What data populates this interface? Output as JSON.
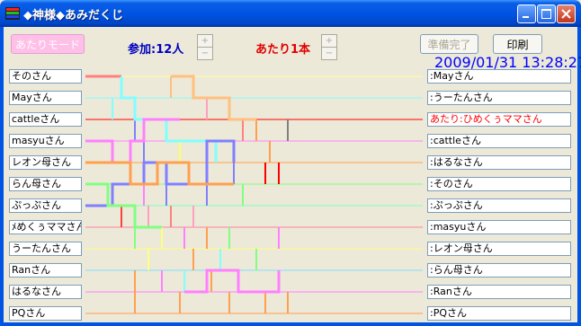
{
  "window": {
    "title": "◆神様◆あみだくじ"
  },
  "toolbar": {
    "atari_mode": "あたりモード",
    "participants": "参加:12人",
    "hits": "あたり1本",
    "ready": "準備完了",
    "print": "印刷",
    "spin_up": "+",
    "spin_down": "−"
  },
  "datetime": "2009/01/31 13:28:27",
  "participants": [
    "そのさん",
    "Mayさん",
    "cattleさん",
    "masyuさん",
    "レオン母さん",
    "らん母さん",
    "ぷっぷさん",
    "ﾒめくぅママさん",
    "うーたんさん",
    "Ranさん",
    "はるなさん",
    "PQさん"
  ],
  "results": [
    ":Mayさん",
    ":うーたんさん",
    "あたり:ひめくぅママさん",
    ":cattleさん",
    ":はるなさん",
    ":そのさん",
    ":ぷっぷさん",
    ":masyuさん",
    ":レオン母さん",
    ":らん母さん",
    ":Ranさん",
    ":PQさん"
  ],
  "colors": {
    "lanes": [
      "#ffffa0",
      "#80ffff",
      "#ff0000",
      "#ff80ff",
      "#ffa050",
      "#80ff80",
      "#80ffc0",
      "#ff80a0",
      "#ffff80",
      "#80e0ff",
      "#ff80ff",
      "#ffa050"
    ],
    "hit": "#ff0000"
  }
}
